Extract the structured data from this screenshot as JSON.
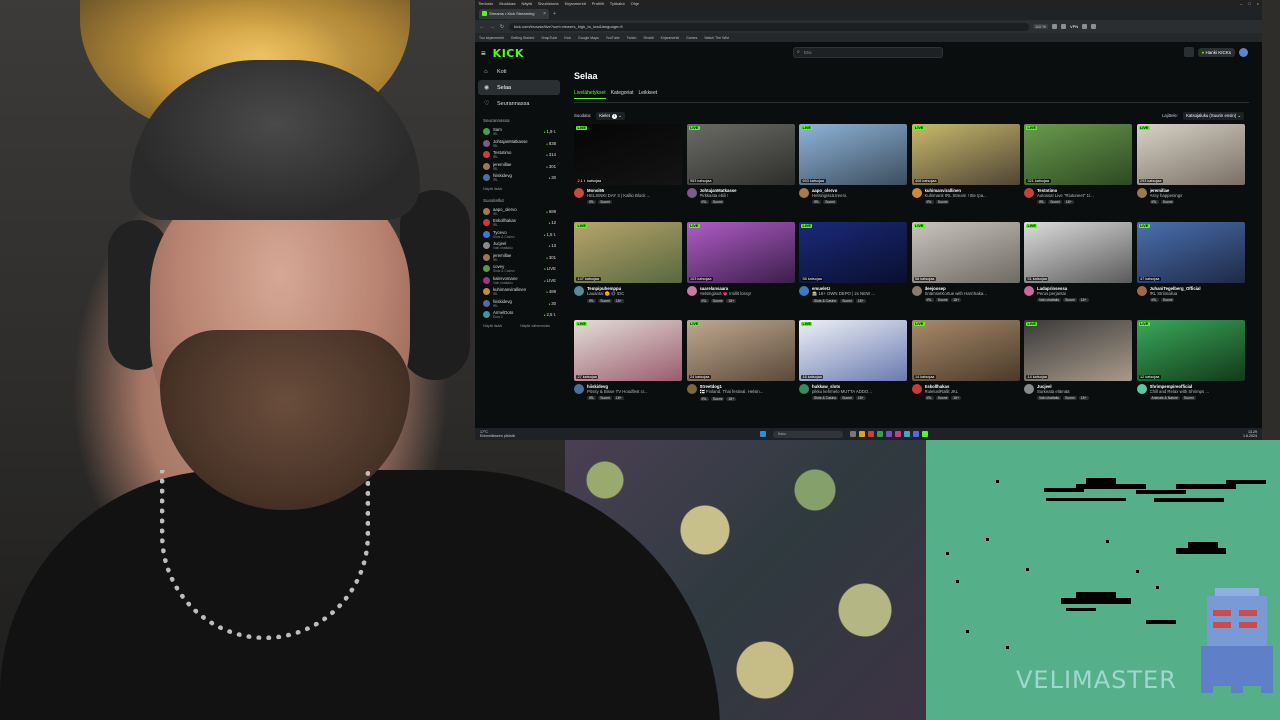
{
  "os": {
    "menu": [
      "Tiedosto",
      "Muokkaa",
      "Näytä",
      "Sivuhistoria",
      "Kirjanmerkit",
      "Profiilit",
      "Työkalut",
      "Ohje"
    ],
    "window_controls": [
      "–",
      "□",
      "×"
    ]
  },
  "browser": {
    "tab_title": "Streams • Kick Streaming",
    "url": "kick.com/browse/live?sort=viewers_high_to_low&language=fi",
    "zoom": "110 %",
    "vpn": "VPN",
    "bookmarks": [
      "Tuo kirjanmerkit",
      "Getting Started",
      "SnapTube",
      "Kick",
      "Google Maps",
      "YouTube",
      "Twitch",
      "Reddit",
      "Kirjanmerkit",
      "Games",
      "Watch The Wild"
    ]
  },
  "kick": {
    "logo": "KICK",
    "search_placeholder": "Etsi",
    "get_kicks": "Hanki KICKs",
    "nav": [
      {
        "icon": "⌂",
        "label": "Koti"
      },
      {
        "icon": "◉",
        "label": "Selaa"
      },
      {
        "icon": "♡",
        "label": "Seurannassa"
      }
    ],
    "followed_title": "Seurannassa",
    "followed": [
      {
        "name": "Sam",
        "sub": "IRL",
        "viewers": "1,9 t.",
        "color": "#3fa34d"
      },
      {
        "name": "JohtajanMatkasse",
        "sub": "IRL",
        "viewers": "838",
        "color": "#7a5c8a"
      },
      {
        "name": "Testotimo",
        "sub": "IRL",
        "viewers": "314",
        "color": "#c1453a"
      },
      {
        "name": "jeremillae",
        "sub": "IRL",
        "viewers": "301",
        "color": "#9a7a50"
      },
      {
        "name": "hiiskidevg",
        "sub": "IRL",
        "viewers": "30",
        "color": "#4d6fa0"
      }
    ],
    "followed_more": "Näytä lisää",
    "recommended_title": "Suositellut",
    "recommended": [
      {
        "name": "aapo_olervo",
        "sub": "IRL",
        "viewers": "689",
        "color": "#a87a4a"
      },
      {
        "name": "Eskollhakas",
        "sub": "IRL",
        "viewers": "12",
        "color": "#c93a3a"
      },
      {
        "name": "Tycevo",
        "sub": "Slots & Casino",
        "viewers": "1,5 t.",
        "color": "#3a7ac9"
      },
      {
        "name": "Jucjeel",
        "sub": "Vain chattailu",
        "viewers": "13",
        "color": "#8a8a8a"
      },
      {
        "name": "jeremillae",
        "sub": "IRL",
        "viewers": "301",
        "color": "#9a7a50"
      },
      {
        "name": "covey",
        "sub": "Slots & Casino",
        "viewers": "LIVE",
        "color": "#5f9a3a"
      },
      {
        "name": "kalervomane",
        "sub": "Vain chattailu",
        "viewers": "LIVE",
        "color": "#9a3a7a"
      },
      {
        "name": "kuhimanvirallinen",
        "sub": "IRL",
        "viewers": "489",
        "color": "#c98a3a"
      },
      {
        "name": "hiiskidevg",
        "sub": "IRL",
        "viewers": "30",
        "color": "#4d6fa0"
      },
      {
        "name": "ArmelDoto",
        "sub": "Dota 2",
        "viewers": "2,5 t.",
        "color": "#3a9a9a"
      }
    ],
    "recommended_more": "Näytä lisää",
    "recommended_less": "Näytä vähemmän",
    "page_title": "Selaa",
    "tabs": [
      "Livelähetykset",
      "Kategoriat",
      "Leikkeet"
    ],
    "active_tab": 0,
    "filter_label": "Suodata:",
    "filter_value": "Kielet",
    "filter_count": "1",
    "sort_label": "Lajittele:",
    "sort_value": "Katsojaluku (Suurin ensin)",
    "live_label": "LIVE",
    "streams": [
      {
        "viewers": "2,1 t. katsojaa",
        "channel": "Monsi95",
        "title": "HELSINKI DAY 3 | Kallio Block ...",
        "tags": [
          "IRL",
          "Suomi"
        ],
        "thumb": [
          "#050505",
          "#141414"
        ],
        "avatar": "#c64c3b"
      },
      {
        "viewers": "953 katsojaa",
        "channel": "JohtajanMatkasse",
        "title": "Pirkkasta ebili !",
        "tags": [
          "IRL",
          "Suomi"
        ],
        "thumb": [
          "#6b6b66",
          "#2e2e2c"
        ],
        "avatar": "#7a5c8a"
      },
      {
        "viewers": "693 katsojaa",
        "channel": "aapo_olervo",
        "title": "Helsingissä.treeni.",
        "tags": [
          "IRL",
          "Suomi"
        ],
        "thumb": [
          "#8fb3d9",
          "#3c4e5d"
        ],
        "avatar": "#a87a4a"
      },
      {
        "viewers": "408 katsojaa",
        "channel": "kuhimanvirallinen",
        "title": "Kuhimanit IRL Stream ! Itte Ipa...",
        "tags": [
          "IRL",
          "Suomi"
        ],
        "thumb": [
          "#c9b96a",
          "#4e4536"
        ],
        "avatar": "#c98a3a"
      },
      {
        "viewers": "321 katsojaa",
        "channel": "Testotimo",
        "title": "Autossa! Live \"Riutuneet\" 1/...",
        "tags": [
          "IRL",
          "Suomi",
          "18+"
        ],
        "thumb": [
          "#6b9a4e",
          "#2d4a22"
        ],
        "avatar": "#c1453a"
      },
      {
        "viewers": "293 katsojaa",
        "channel": "jeremillae",
        "title": "Assy happenings",
        "tags": [
          "IRL",
          "Suomi"
        ],
        "thumb": [
          "#d7d2c6",
          "#7a6f66"
        ],
        "avatar": "#9a7a50"
      },
      {
        "viewers": "147 katsojaa",
        "channel": "Tempipuhemppu",
        "title": "Lauantai 🌞 @ IDC",
        "tags": [
          "IRL",
          "Suomi",
          "18+"
        ],
        "thumb": [
          "#b8a46c",
          "#58693f"
        ],
        "avatar": "#5a8a9a"
      },
      {
        "viewers": "103 katsojaa",
        "channel": "saarelansaara",
        "title": "Helsingissä 💗 Imillit lossy!",
        "tags": [
          "IRL",
          "Suomi",
          "18+"
        ],
        "thumb": [
          "#b05cc6",
          "#3a1f4a"
        ],
        "avatar": "#c97aa0"
      },
      {
        "viewers": "58 katsojaa",
        "channel": "emueletz",
        "title": "🎰 18+ OWN DEPO | 2x NEW ...",
        "tags": [
          "Slots & Casino",
          "Suomi",
          "18+"
        ],
        "thumb": [
          "#1a2a7a",
          "#0a0f2e"
        ],
        "avatar": "#3a7ac9"
      },
      {
        "viewers": "58 katsojaa",
        "channel": "deejoosep",
        "title": "SnämsetKortue with HarriSaka...",
        "tags": [
          "IRL",
          "Suomi",
          "18+"
        ],
        "thumb": [
          "#c9c4bc",
          "#6e6a64"
        ],
        "avatar": "#8a7a6a"
      },
      {
        "viewers": "51 katsojaa",
        "channel": "Ladaprinsessa",
        "title": "Perus perjantai",
        "tags": [
          "Vain chattailu",
          "Suomi",
          "18+"
        ],
        "thumb": [
          "#dcdcdc",
          "#5a5a5a"
        ],
        "avatar": "#c96a9a"
      },
      {
        "viewers": "47 katsojaa",
        "channel": "JuhaniTegelberg_Official",
        "title": "IRL Striimailua",
        "tags": [
          "IRL",
          "Suomi"
        ],
        "thumb": [
          "#4a6fb0",
          "#1e2a45"
        ],
        "avatar": "#a06a4a"
      },
      {
        "viewers": "27 katsojaa",
        "channel": "hiiskidevg",
        "title": "Pössy & Bisse TV Hoodfest cr...",
        "tags": [
          "IRL",
          "Suomi",
          "18+"
        ],
        "thumb": [
          "#e3ddd6",
          "#9a5c70"
        ],
        "avatar": "#4d6fa0"
      },
      {
        "viewers": "24 katsojaa",
        "channel": "Streetdog1",
        "title": "🇫🇮 Finland. Thai festival. Helsin...",
        "tags": [
          "IRL",
          "Suomi",
          "18+"
        ],
        "thumb": [
          "#c0a890",
          "#5a4a3a"
        ],
        "avatar": "#7a6a3a"
      },
      {
        "viewers": "16 katsojaa",
        "channel": "hukkaw_slots",
        "title": "pikku kehmelo MUTTA ADDO...",
        "tags": [
          "Slots & Casino",
          "Suomi",
          "18+"
        ],
        "thumb": [
          "#eef0f6",
          "#6a7ab0"
        ],
        "avatar": "#3a8a5a"
      },
      {
        "viewers": "14 katsojaa",
        "channel": "Eskollhakas",
        "title": "RuletuslRallit JKL",
        "tags": [
          "IRL",
          "Suomi",
          "18+"
        ],
        "thumb": [
          "#a88a6a",
          "#4a3a2a"
        ],
        "avatar": "#c93a3a"
      },
      {
        "viewers": "14 katsojaa",
        "channel": "Jucjeel",
        "title": "Surkeata elämää",
        "tags": [
          "Vain chattailu",
          "Suomi",
          "18+"
        ],
        "thumb": [
          "#3a3a3a",
          "#a89a8a"
        ],
        "avatar": "#8a8a8a"
      },
      {
        "viewers": "12 katsojaa",
        "channel": "Shrimpempireofficial",
        "title": "Chill and Relax with Shrimps ...",
        "tags": [
          "Animals & Nature",
          "Suomi"
        ],
        "thumb": [
          "#3aa85a",
          "#123a1a"
        ],
        "avatar": "#5ac9a0"
      }
    ]
  },
  "taskbar": {
    "weather_temp": "17°C",
    "weather_text": "Enimmäkseen pilvistä",
    "search": "Haku",
    "time": "13.29",
    "date": "1.6.2024"
  },
  "overlay": {
    "game_logo": "VELIMASTER"
  }
}
